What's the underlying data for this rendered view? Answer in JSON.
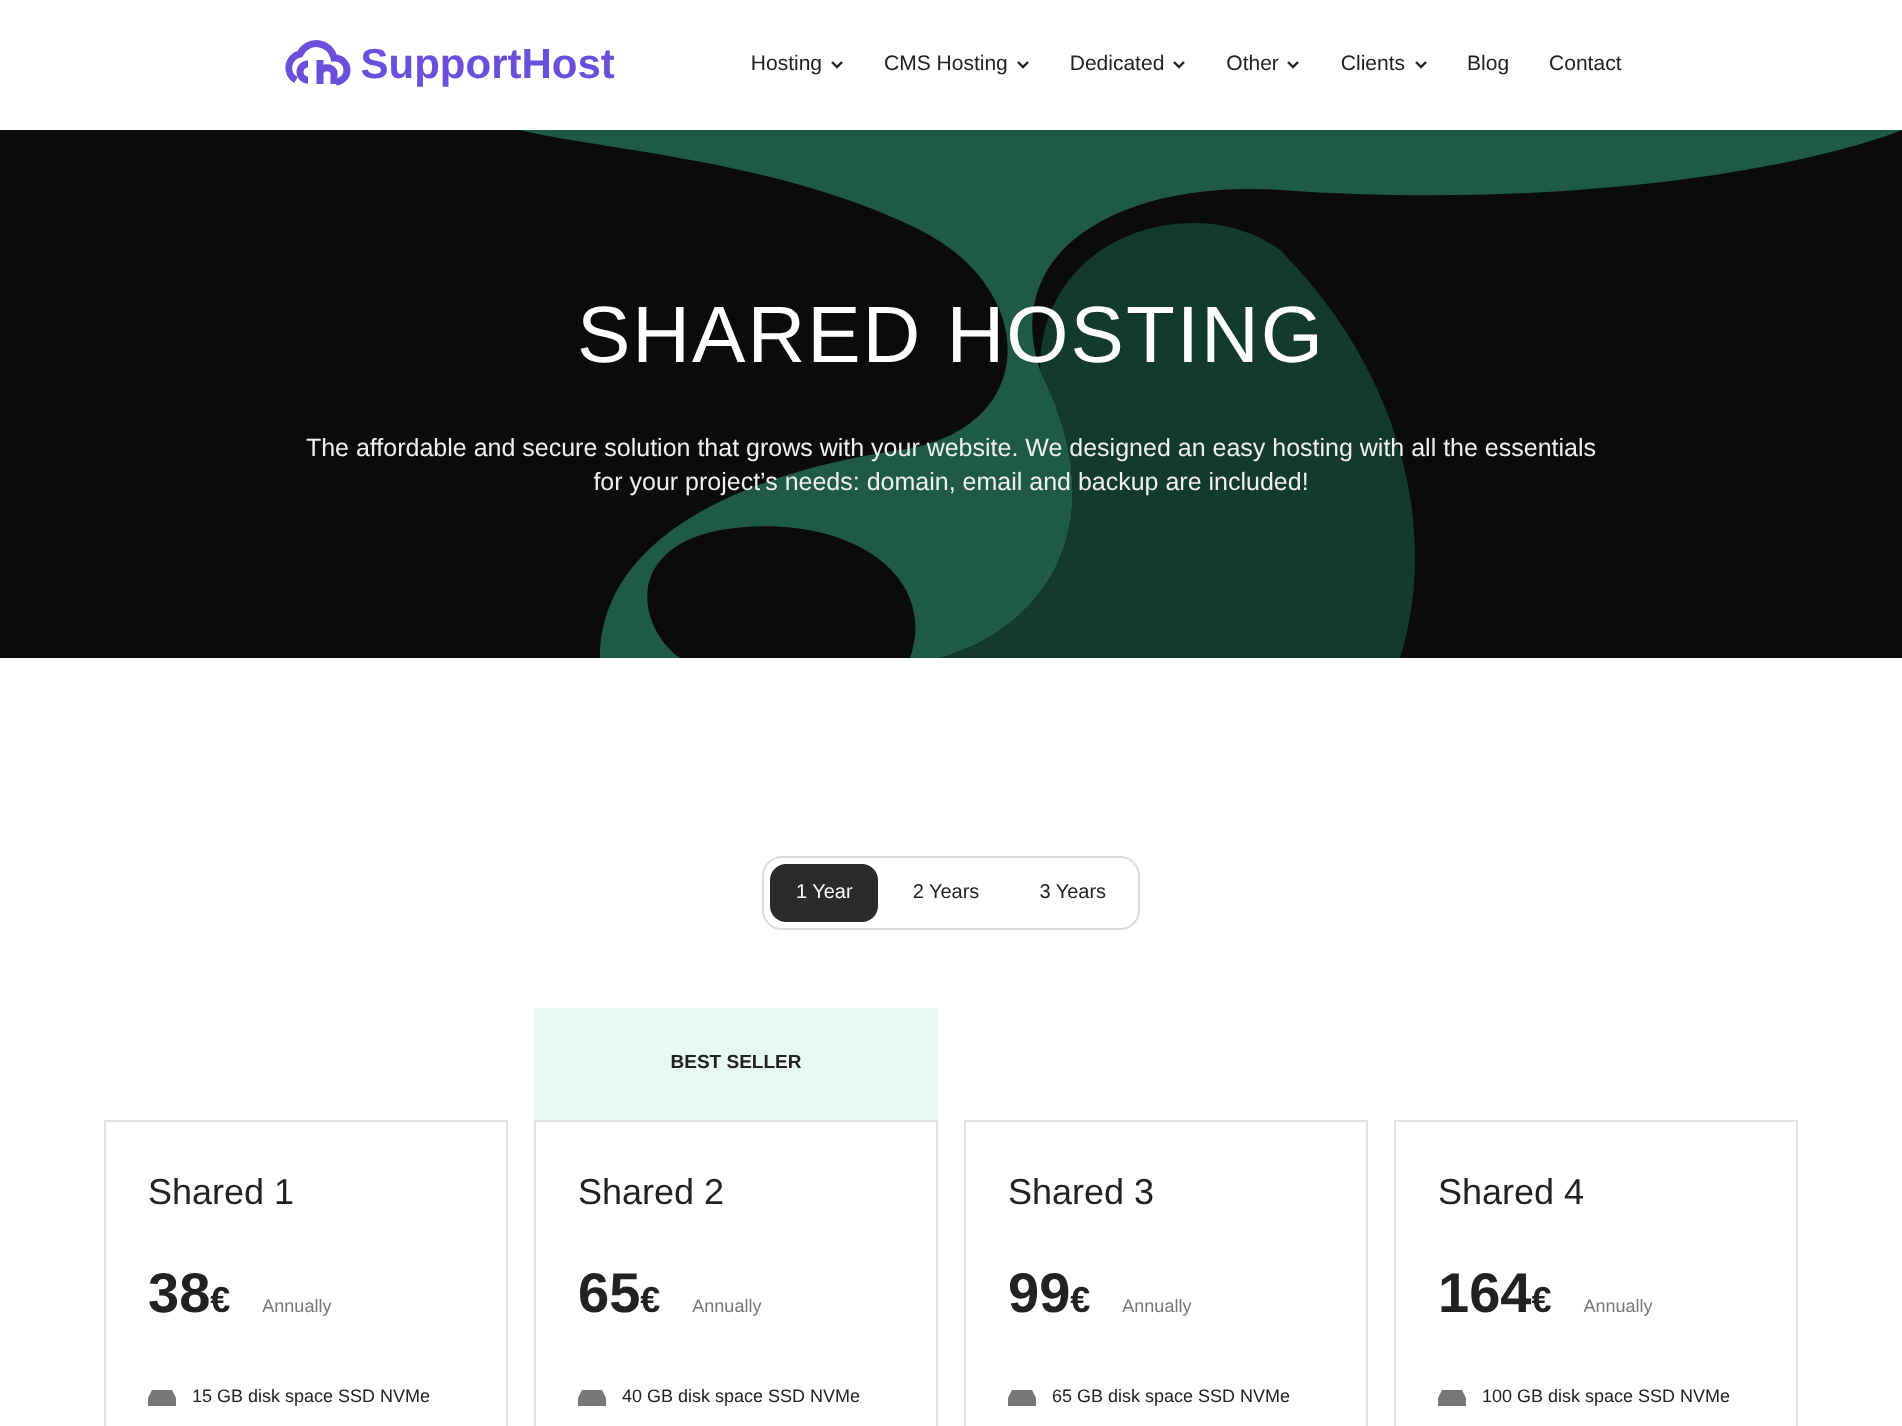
{
  "brand": {
    "name": "SupportHost"
  },
  "nav": [
    {
      "label": "Hosting",
      "dropdown": true
    },
    {
      "label": "CMS Hosting",
      "dropdown": true
    },
    {
      "label": "Dedicated",
      "dropdown": true
    },
    {
      "label": "Other",
      "dropdown": true
    },
    {
      "label": "Clients",
      "dropdown": true
    },
    {
      "label": "Blog",
      "dropdown": false
    },
    {
      "label": "Contact",
      "dropdown": false
    }
  ],
  "hero": {
    "title": "SHARED HOSTING",
    "text": "The affordable and secure solution that grows with your website. We designed an easy hosting with all the essentials for your project’s needs: domain, email and backup are included!"
  },
  "periods": [
    {
      "label": "1 Year",
      "selected": true
    },
    {
      "label": "2 Years",
      "selected": false
    },
    {
      "label": "3 Years",
      "selected": false
    }
  ],
  "plans": [
    {
      "name": "Shared 1",
      "price": "38",
      "currency": "€",
      "period": "Annually",
      "featured": false,
      "features": [
        "15 GB disk space SSD NVMe"
      ]
    },
    {
      "name": "Shared 2",
      "price": "65",
      "currency": "€",
      "period": "Annually",
      "featured": true,
      "ribbon": "BEST SELLER",
      "features": [
        "40 GB disk space SSD NVMe"
      ]
    },
    {
      "name": "Shared 3",
      "price": "99",
      "currency": "€",
      "period": "Annually",
      "featured": false,
      "features": [
        "65 GB disk space SSD NVMe"
      ]
    },
    {
      "name": "Shared 4",
      "price": "164",
      "currency": "€",
      "period": "Annually",
      "featured": false,
      "features": [
        "100 GB disk space SSD NVMe"
      ]
    }
  ]
}
